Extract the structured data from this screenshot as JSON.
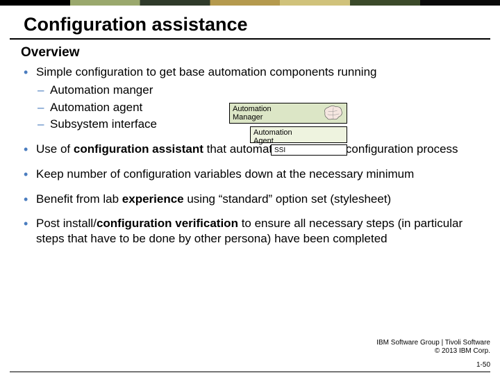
{
  "title": "Configuration assistance",
  "subtitle": "Overview",
  "bullets": {
    "b0": {
      "text": "Simple configuration to get base automation components running",
      "sub": [
        "Automation manger",
        "Automation agent",
        "Subsystem interface"
      ]
    },
    "b1": {
      "pre": "Use of ",
      "bold": "configuration assistant",
      "post": " that automates majority of configuration process"
    },
    "b2": {
      "text": "Keep number of configuration variables down at the necessary minimum"
    },
    "b3": {
      "pre": "Benefit from lab ",
      "bold": "experience",
      "post": " using “standard” option set (stylesheet)"
    },
    "b4": {
      "pre": "Post install/",
      "bold": "configuration verification",
      "post": " to ensure all necessary steps (in particular steps that have to be done by other persona) have been completed"
    }
  },
  "diagram": {
    "manager": "Automation\nManager",
    "agent": "Automation\nAgent",
    "ssi": "SSI"
  },
  "footer": {
    "line1": "IBM Software Group | Tivoli Software",
    "line2": "© 2013 IBM Corp.",
    "page": "1-50"
  }
}
